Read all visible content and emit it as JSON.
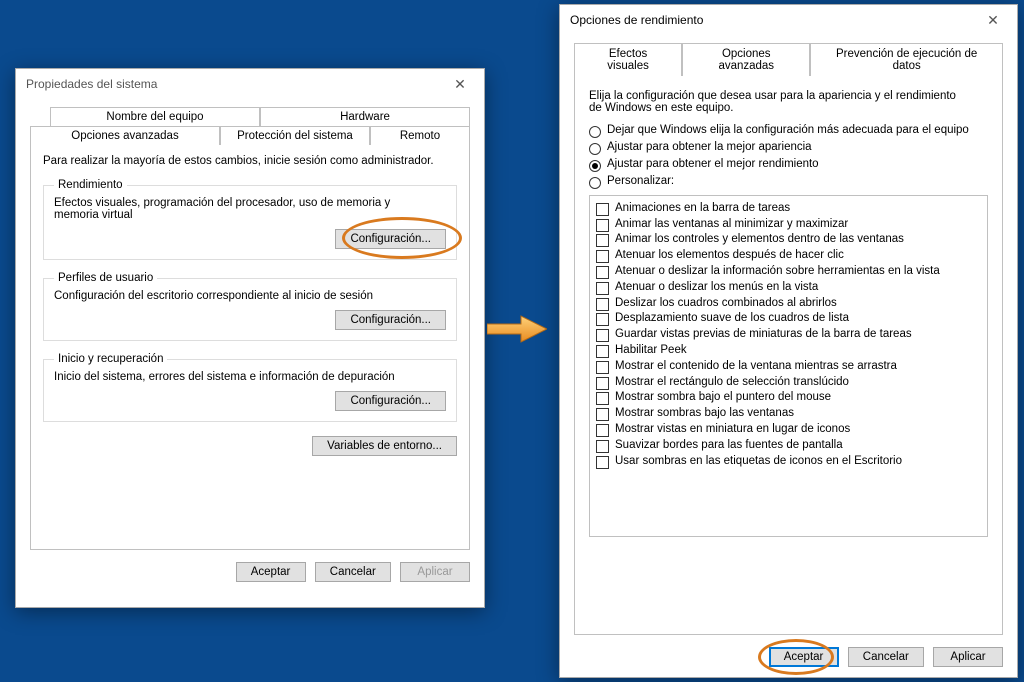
{
  "left": {
    "title": "Propiedades del sistema",
    "tabs_row1": [
      "Nombre del equipo",
      "Hardware"
    ],
    "tabs_row2": [
      "Opciones avanzadas",
      "Protección del sistema",
      "Remoto"
    ],
    "active_tab": "Opciones avanzadas",
    "intro": "Para realizar la mayoría de estos cambios, inicie sesión como administrador.",
    "groups": {
      "perf": {
        "legend": "Rendimiento",
        "desc": "Efectos visuales, programación del procesador, uso de memoria y memoria virtual",
        "button": "Configuración..."
      },
      "profiles": {
        "legend": "Perfiles de usuario",
        "desc": "Configuración del escritorio correspondiente al inicio de sesión",
        "button": "Configuración..."
      },
      "startup": {
        "legend": "Inicio y recuperación",
        "desc": "Inicio del sistema, errores del sistema e información de depuración",
        "button": "Configuración..."
      }
    },
    "envvars": "Variables de entorno...",
    "buttons": {
      "ok": "Aceptar",
      "cancel": "Cancelar",
      "apply": "Aplicar"
    }
  },
  "right": {
    "title": "Opciones de rendimiento",
    "tabs": [
      "Efectos visuales",
      "Opciones avanzadas",
      "Prevención de ejecución de datos"
    ],
    "active_tab": "Efectos visuales",
    "intro": "Elija la configuración que desea usar para la apariencia y el rendimiento de Windows en este equipo.",
    "radios": [
      "Dejar que Windows elija la configuración más adecuada para el equipo",
      "Ajustar para obtener la mejor apariencia",
      "Ajustar para obtener el mejor rendimiento",
      "Personalizar:"
    ],
    "selected_radio_index": 2,
    "checks": [
      "Animaciones en la barra de tareas",
      "Animar las ventanas al minimizar y maximizar",
      "Animar los controles y elementos dentro de las ventanas",
      "Atenuar los elementos después de hacer clic",
      "Atenuar o deslizar la información sobre herramientas en la vista",
      "Atenuar o deslizar los menús en la vista",
      "Deslizar los cuadros combinados al abrirlos",
      "Desplazamiento suave de los cuadros de lista",
      "Guardar vistas previas de miniaturas de la barra de tareas",
      "Habilitar Peek",
      "Mostrar el contenido de la ventana mientras se arrastra",
      "Mostrar el rectángulo de selección translúcido",
      "Mostrar sombra bajo el puntero del mouse",
      "Mostrar sombras bajo las ventanas",
      "Mostrar vistas en miniatura en lugar de iconos",
      "Suavizar bordes para las fuentes de pantalla",
      "Usar sombras en las etiquetas de iconos en el Escritorio"
    ],
    "buttons": {
      "ok": "Aceptar",
      "cancel": "Cancelar",
      "apply": "Aplicar"
    }
  }
}
